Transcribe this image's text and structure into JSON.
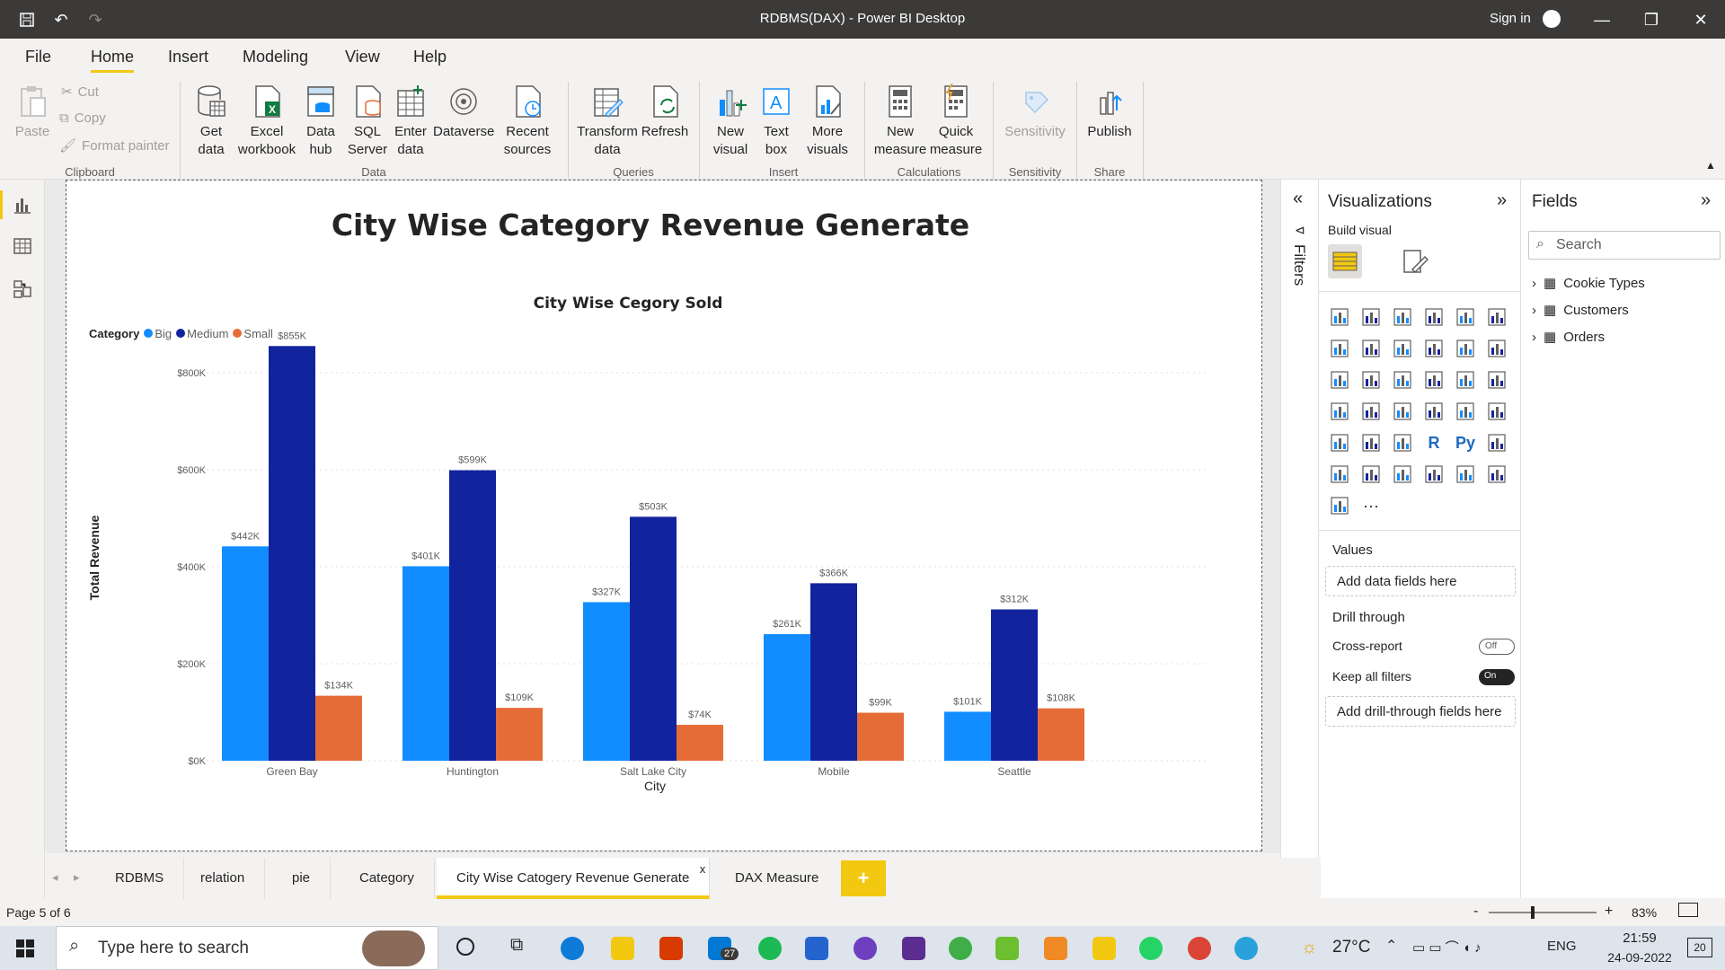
{
  "window": {
    "title": "RDBMS(DAX) - Power BI Desktop",
    "sign_in": "Sign in"
  },
  "menu": [
    "File",
    "Home",
    "Insert",
    "Modeling",
    "View",
    "Help"
  ],
  "ribbon": {
    "clipboard": {
      "paste": "Paste",
      "cut": "Cut",
      "copy": "Copy",
      "format_painter": "Format painter",
      "group": "Clipboard"
    },
    "data": {
      "get_data": "Get data",
      "excel": "Excel workbook",
      "data_hub": "Data hub",
      "sql": "SQL Server",
      "enter": "Enter data",
      "dataverse": "Dataverse",
      "recent": "Recent sources",
      "group": "Data"
    },
    "queries": {
      "transform": "Transform data",
      "refresh": "Refresh",
      "group": "Queries"
    },
    "insert": {
      "new_visual": "New visual",
      "text_box": "Text box",
      "more_visuals": "More visuals",
      "group": "Insert"
    },
    "calculations": {
      "new_measure": "New measure",
      "quick_measure": "Quick measure",
      "group": "Calculations"
    },
    "sensitivity": {
      "label": "Sensitivity",
      "group": "Sensitivity"
    },
    "share": {
      "publish": "Publish",
      "group": "Share"
    }
  },
  "report": {
    "title": "City Wise Category Revenue Generate"
  },
  "chart_data": {
    "type": "bar",
    "title": "City Wise Cegory Sold",
    "legend_title": "Category",
    "legend_position": "top-left",
    "xlabel": "City",
    "ylabel": "Total Revenue",
    "categories": [
      "Green Bay",
      "Huntington",
      "Salt Lake City",
      "Mobile",
      "Seattle"
    ],
    "ylim": [
      0,
      900
    ],
    "yticks": [
      0,
      200,
      400,
      600,
      800
    ],
    "ytick_labels": [
      "$0K",
      "$200K",
      "$400K",
      "$600K",
      "$800K"
    ],
    "grid": true,
    "series": [
      {
        "name": "Big",
        "color": "#118dff",
        "values": [
          442,
          401,
          327,
          261,
          101
        ],
        "labels": [
          "$442K",
          "$401K",
          "$327K",
          "$261K",
          "$101K"
        ]
      },
      {
        "name": "Medium",
        "color": "#12239e",
        "values": [
          855,
          599,
          503,
          366,
          312
        ],
        "labels": [
          "$855K",
          "$599K",
          "$503K",
          "$366K",
          "$312K"
        ]
      },
      {
        "name": "Small",
        "color": "#e66c37",
        "values": [
          134,
          109,
          74,
          99,
          108
        ],
        "labels": [
          "$134K",
          "$109K",
          "$74K",
          "$99K",
          "$108K"
        ]
      }
    ]
  },
  "filters": {
    "label": "Filters"
  },
  "visualizations": {
    "title": "Visualizations",
    "build_visual": "Build visual",
    "values": "Values",
    "add_data": "Add data fields here",
    "drill_through": "Drill through",
    "cross_report": "Cross-report",
    "cross_report_state": "Off",
    "keep_filters": "Keep all filters",
    "keep_filters_state": "On",
    "add_drill": "Add drill-through fields here"
  },
  "fields": {
    "title": "Fields",
    "search_placeholder": "Search",
    "tables": [
      "Cookie Types",
      "Customers",
      "Orders"
    ]
  },
  "tabs": [
    "RDBMS",
    "relation",
    "pie",
    "Category",
    "City Wise Catogery Revenue Generate",
    "DAX Measure"
  ],
  "tab_close": "x",
  "status": {
    "page": "Page 5 of 6",
    "zoom": "83%"
  },
  "taskbar": {
    "search_placeholder": "Type here to search",
    "temp": "27°C",
    "lang": "ENG",
    "time": "21:59",
    "date": "24-09-2022",
    "mail_badge": "27",
    "notif": "20"
  }
}
